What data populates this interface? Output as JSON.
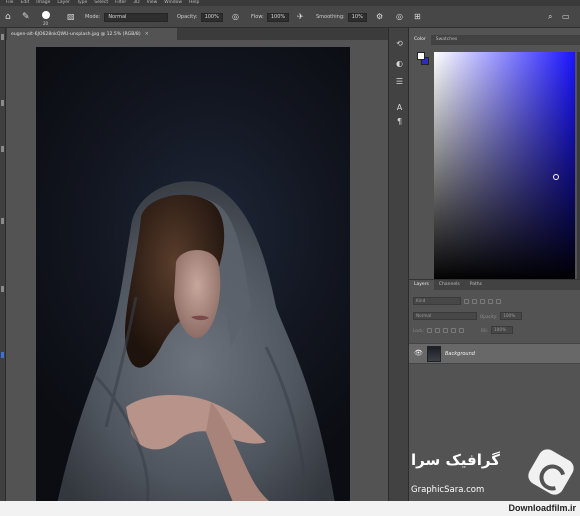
{
  "menu": {
    "items": [
      "File",
      "Edit",
      "Image",
      "Layer",
      "Type",
      "Select",
      "Filter",
      "3D",
      "View",
      "Window",
      "Help"
    ]
  },
  "options": {
    "brush_size": "20",
    "mode_label": "Mode:",
    "mode_value": "Normal",
    "opacity_label": "Opacity:",
    "opacity_value": "100%",
    "flow_label": "Flow:",
    "flow_value": "100%",
    "smoothing_label": "Smoothing:",
    "smoothing_value": "10%"
  },
  "document": {
    "tab_title": "eugen-alt-6JO628nkQWU-unsplash.jpg @ 12.5% (RGB/8)",
    "close": "×"
  },
  "color_panel": {
    "tabs": [
      "Color",
      "Swatches"
    ],
    "fg_color": "#ffffff",
    "bg_color": "#2d2fb8",
    "hue_color": "#1a14ff"
  },
  "layers_panel": {
    "tabs": [
      "Layers",
      "Channels",
      "Paths"
    ],
    "kind_placeholder": "Kind",
    "blend_mode": "Normal",
    "opacity_label": "Opacity:",
    "opacity_value": "100%",
    "lock_label": "Lock:",
    "fill_label": "Fill:",
    "fill_value": "100%",
    "layer": {
      "name": "Background"
    }
  },
  "watermark": {
    "persian": "گرافیک سرا",
    "site": "GraphicSara.com"
  },
  "footer": {
    "text": "Downloadfilm.ir"
  }
}
